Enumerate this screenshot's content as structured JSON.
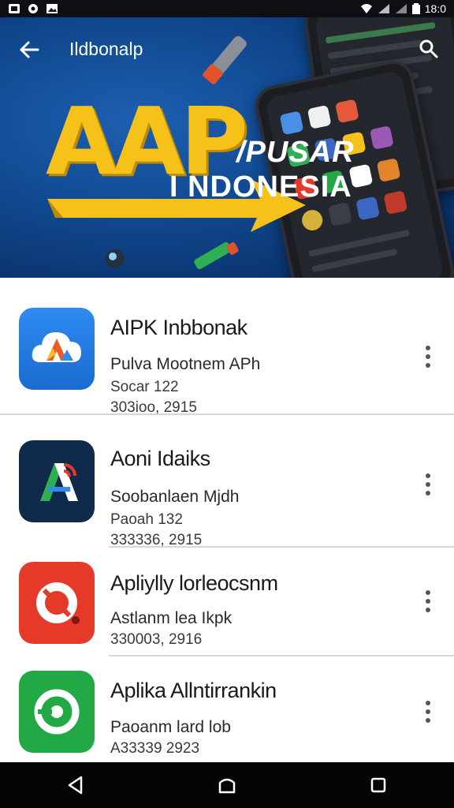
{
  "status_bar": {
    "time": "18:0",
    "icons": [
      "app-notification-icon",
      "settings-notification-icon",
      "image-notification-icon",
      "wifi-icon",
      "signal-icon",
      "signal-icon",
      "battery-icon"
    ]
  },
  "header": {
    "title": "Ildbonalp",
    "back_icon": "arrow-left-icon",
    "search_icon": "search-icon"
  },
  "banner": {
    "logo": "AAP",
    "tagline_line1": "/PUSAR",
    "tagline_line2": "I NDONESIA",
    "accent_color": "#f6c21a",
    "background_color": "#0b3672"
  },
  "apps": [
    {
      "name": "AIPK Inbbonak",
      "description": "Pulva Mootnem APh",
      "category": "Socar 122",
      "meta": "303ioo, 2915",
      "icon": "cloud-a-icon",
      "icon_color": "#1f7be0"
    },
    {
      "name": "Aoni Idaiks",
      "description": "Soobanlaen Mjdh",
      "category": "Paoah 132",
      "meta": "333336, 2915",
      "icon": "a-signal-icon",
      "icon_color": "#0f2a4a"
    },
    {
      "name": "Apliylly lorleocsnm",
      "description": "Astlanm lea Ikpk",
      "category": "",
      "meta": "330003, 2916",
      "icon": "red-ring-icon",
      "icon_color": "#e53a2a"
    },
    {
      "name": "Aplika Allntirrankin",
      "description": "Paoanm lard lob",
      "category": "",
      "meta": "A33339 2923",
      "icon": "green-ring-icon",
      "icon_color": "#22a845"
    }
  ],
  "nav": {
    "back": "back-triangle-icon",
    "home": "home-icon",
    "recents": "recents-square-icon"
  }
}
